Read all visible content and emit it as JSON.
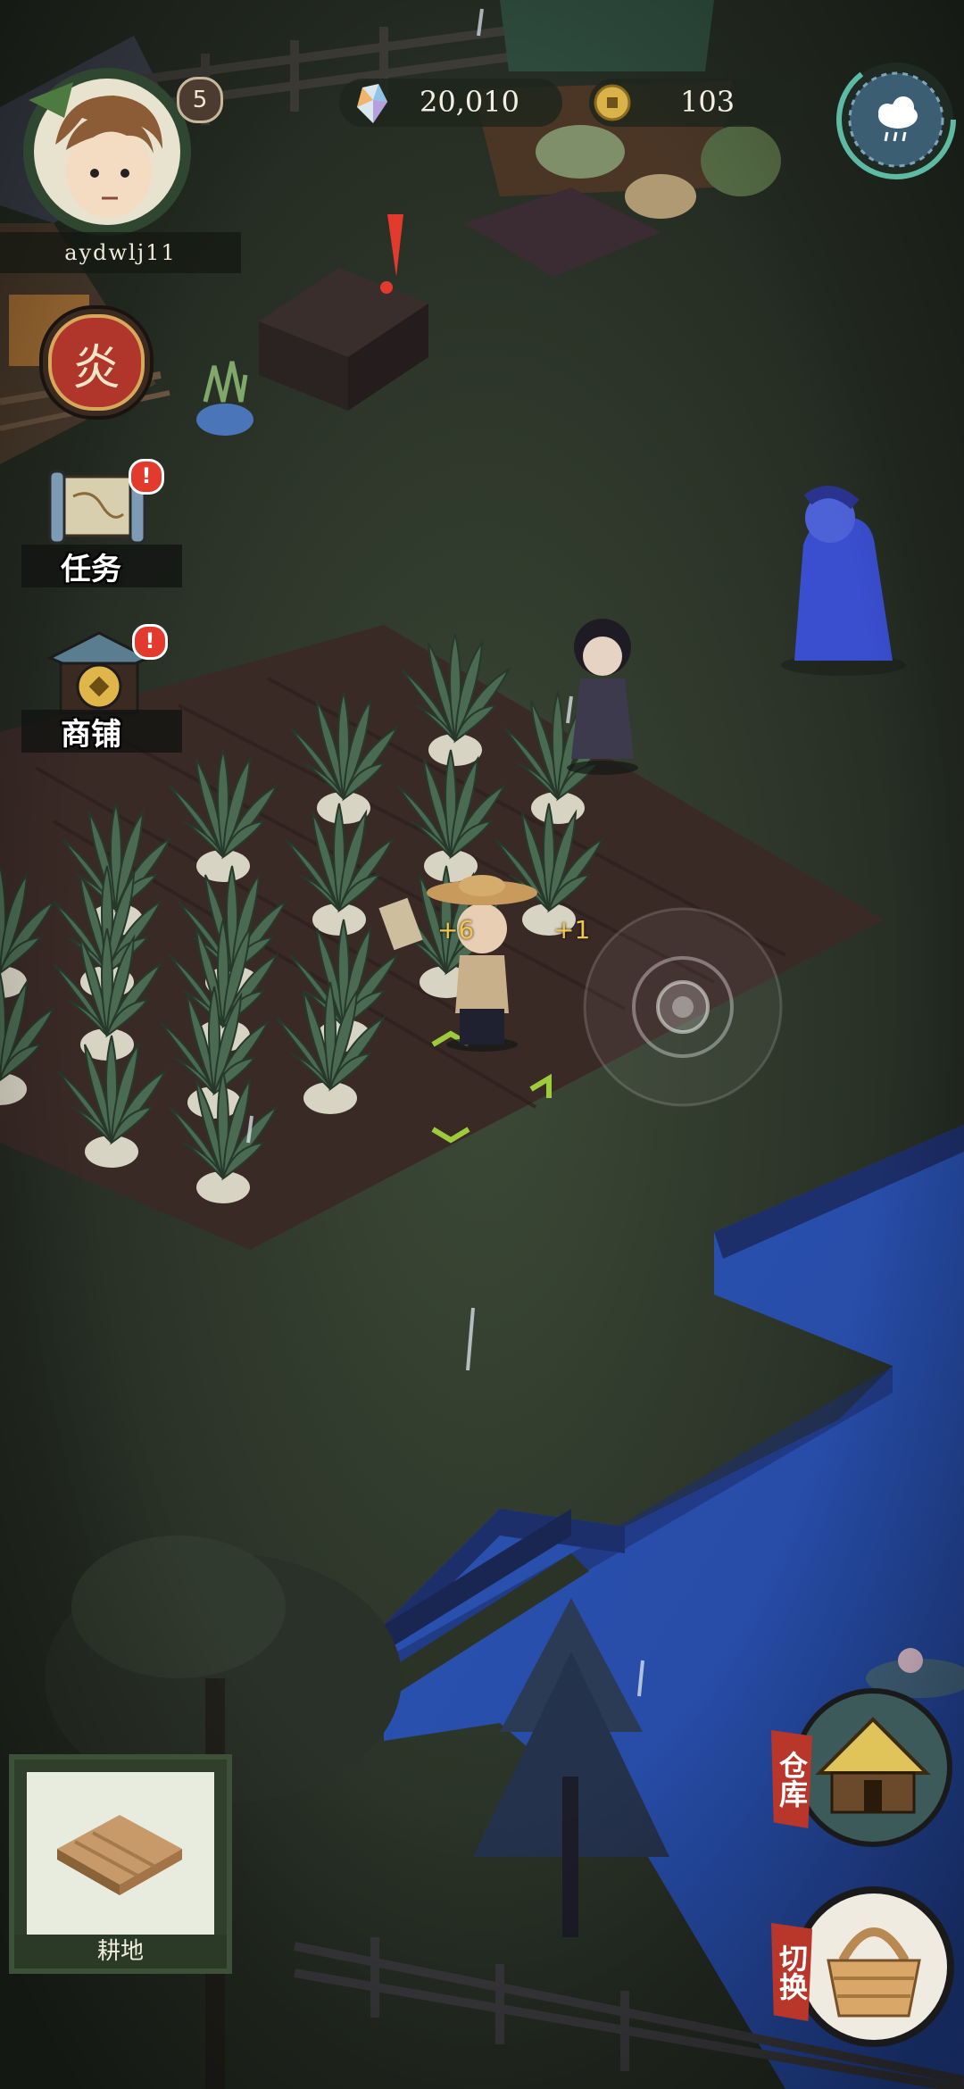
{
  "player": {
    "name": "aydwlj11",
    "level": "5"
  },
  "currency": {
    "gems": "20,010",
    "coins": "103"
  },
  "weather": {
    "icon": "rain-cloud-icon"
  },
  "sidebar": {
    "skill_glyph": "炎",
    "tasks_label": "任务",
    "shop_label": "商铺"
  },
  "field": {
    "yield_a": "+6",
    "yield_b": "+1"
  },
  "bottom": {
    "farmland_label": "耕地",
    "warehouse_label": "仓库",
    "switch_label": "切换"
  },
  "colors": {
    "grass": "#2b3326",
    "soil": "#3a2a26",
    "water": "#2d57b8",
    "alert": "#e23a2c",
    "accent_gold": "#d9b24a"
  }
}
